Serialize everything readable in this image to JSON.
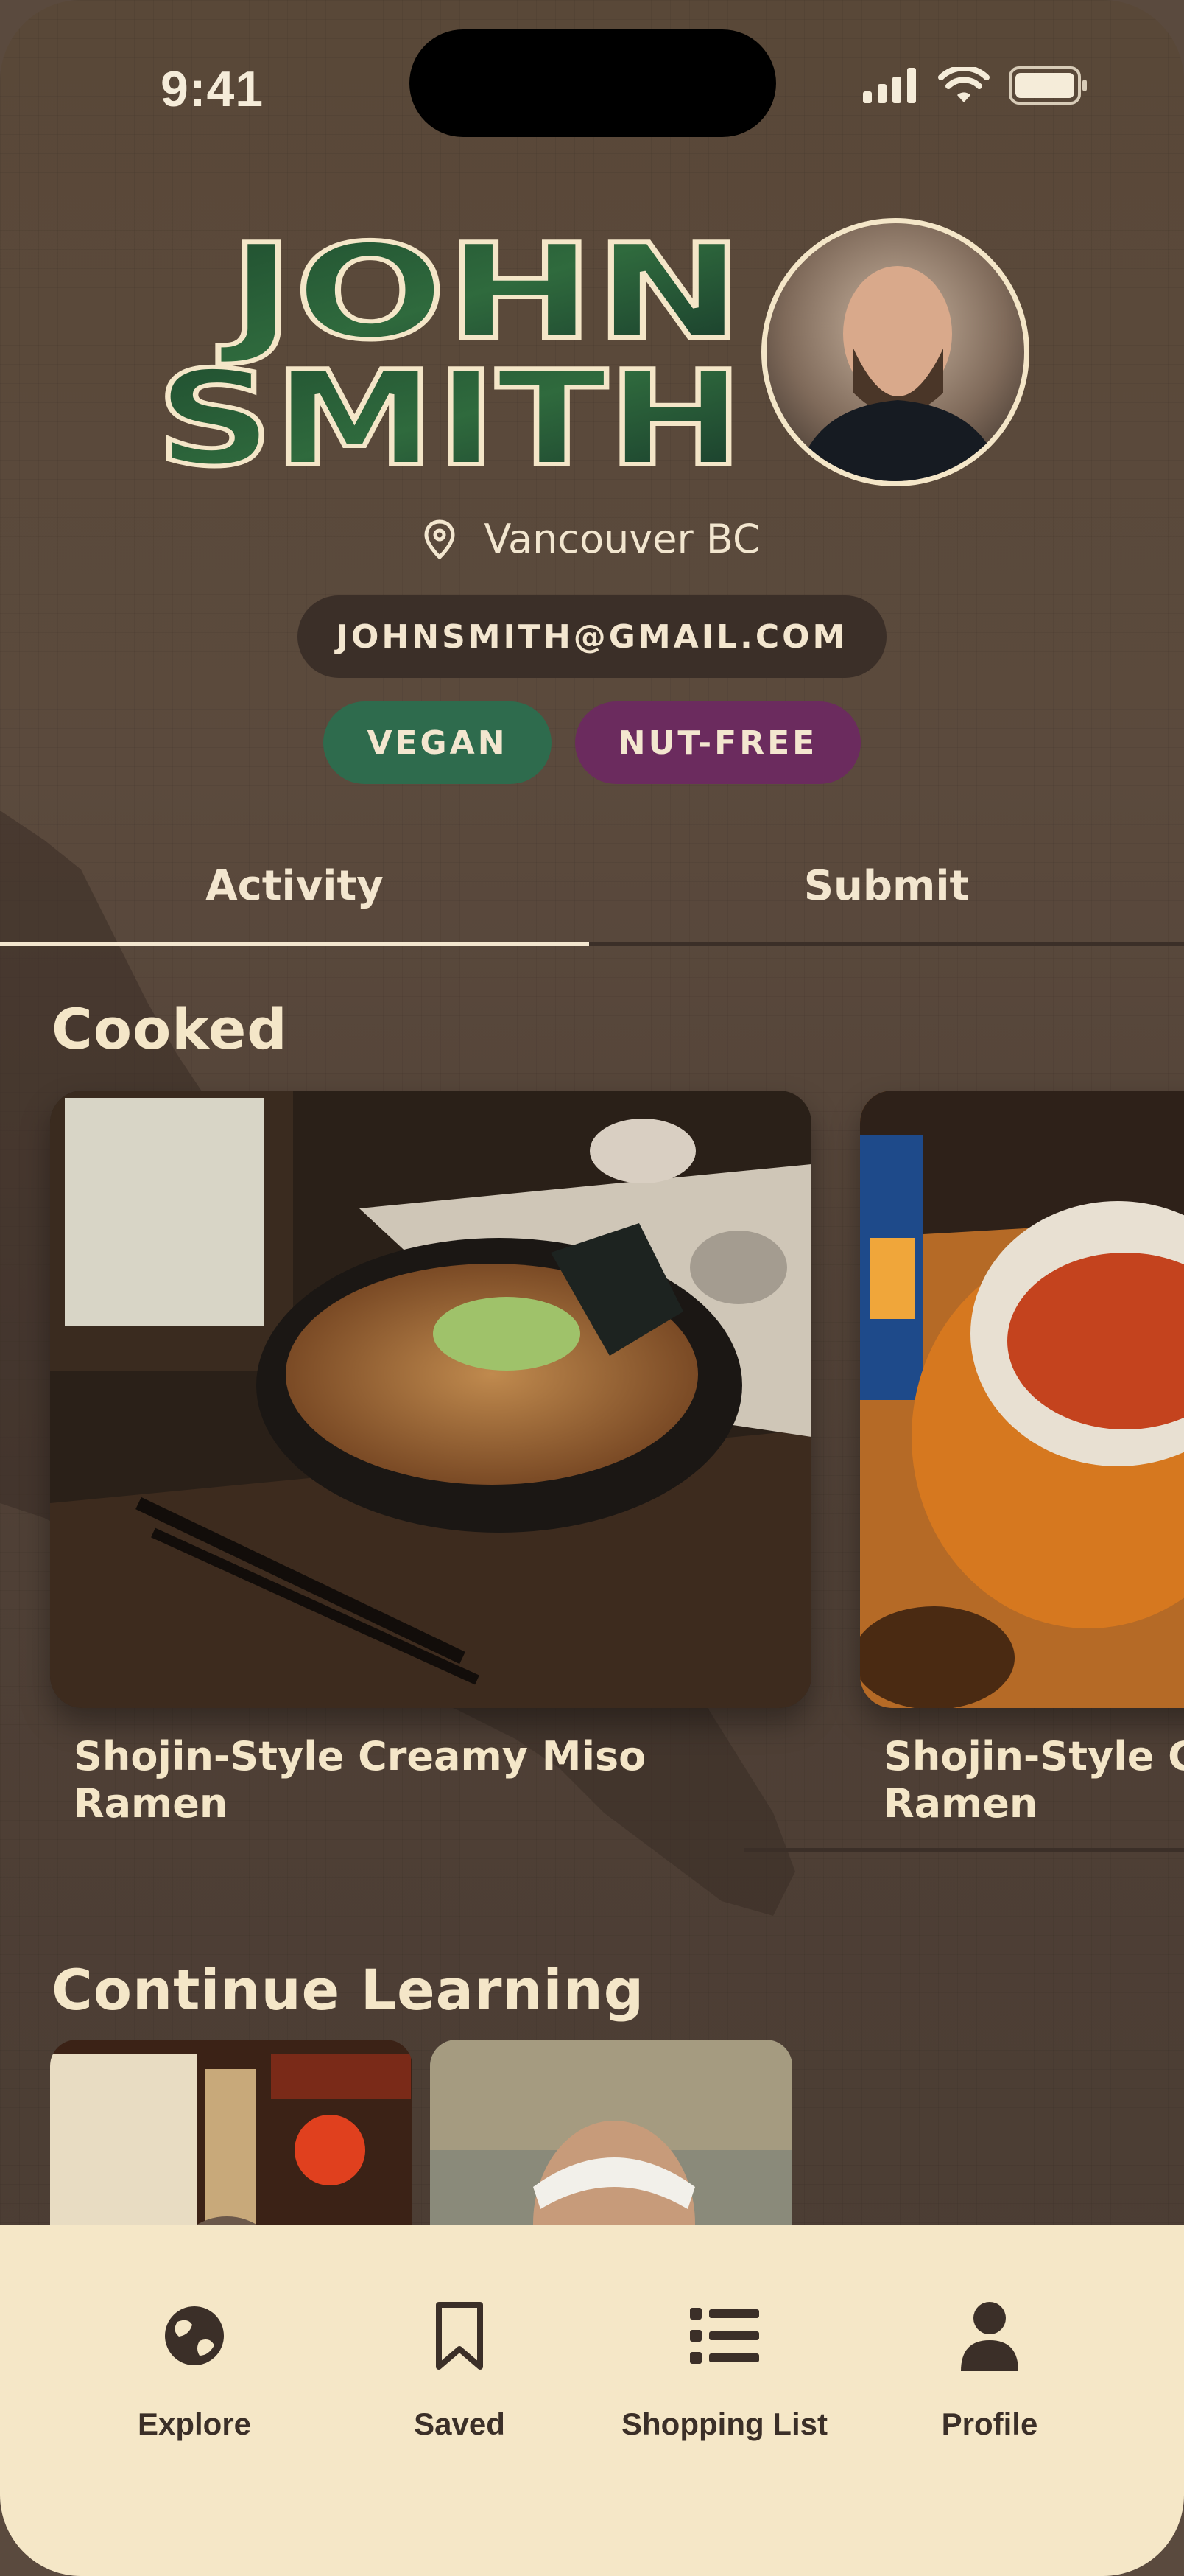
{
  "status_bar": {
    "time": "9:41"
  },
  "profile": {
    "first_name": "JOHN",
    "last_name": "SMITH",
    "location": "Vancouver BC",
    "email": "JOHNSMITH@GMAIL.COM",
    "tags": [
      "VEGAN",
      "NUT-FREE"
    ]
  },
  "tabs": {
    "items": [
      "Activity",
      "Submit"
    ],
    "active": "Activity"
  },
  "sections": {
    "cooked": {
      "title": "Cooked",
      "cards": [
        {
          "title": "Shojin-Style Creamy Miso Ramen"
        },
        {
          "title": "Shojin-Style Creamy Miso Ramen"
        }
      ]
    },
    "learning": {
      "title": "Continue Learning"
    }
  },
  "bottom_nav": [
    {
      "label": "Explore",
      "icon": "globe-icon"
    },
    {
      "label": "Saved",
      "icon": "bookmark-icon"
    },
    {
      "label": "Shopping List",
      "icon": "list-icon"
    },
    {
      "label": "Profile",
      "icon": "person-icon"
    }
  ],
  "colors": {
    "background": "#5a4a3e",
    "cream": "#f4e6c8",
    "dark_pill": "#3b2f28",
    "vegan_tag": "#2e6b4d",
    "nut_free_tag": "#6b2b5e",
    "nav_background": "#f5e7c7"
  }
}
